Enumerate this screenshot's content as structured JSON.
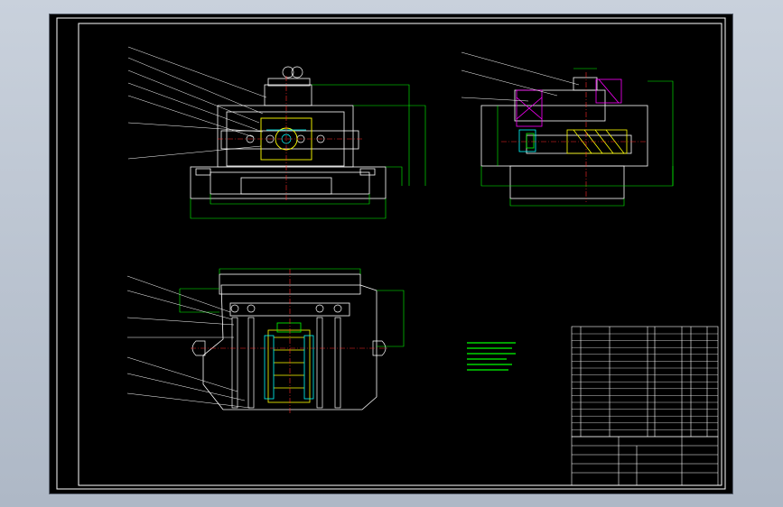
{
  "colors": {
    "background": "#000000",
    "outline": "#ffffff",
    "dimension": "#00ff00",
    "hatch": "#ffff00",
    "centerline": "#ff2a2a",
    "part_cyan": "#00ffff",
    "part_magenta": "#ff00ff",
    "notes": "#00ff00"
  },
  "title_block": {
    "title": "",
    "drawing_name": ""
  },
  "tech_notes": {
    "heading": "",
    "lines": []
  }
}
